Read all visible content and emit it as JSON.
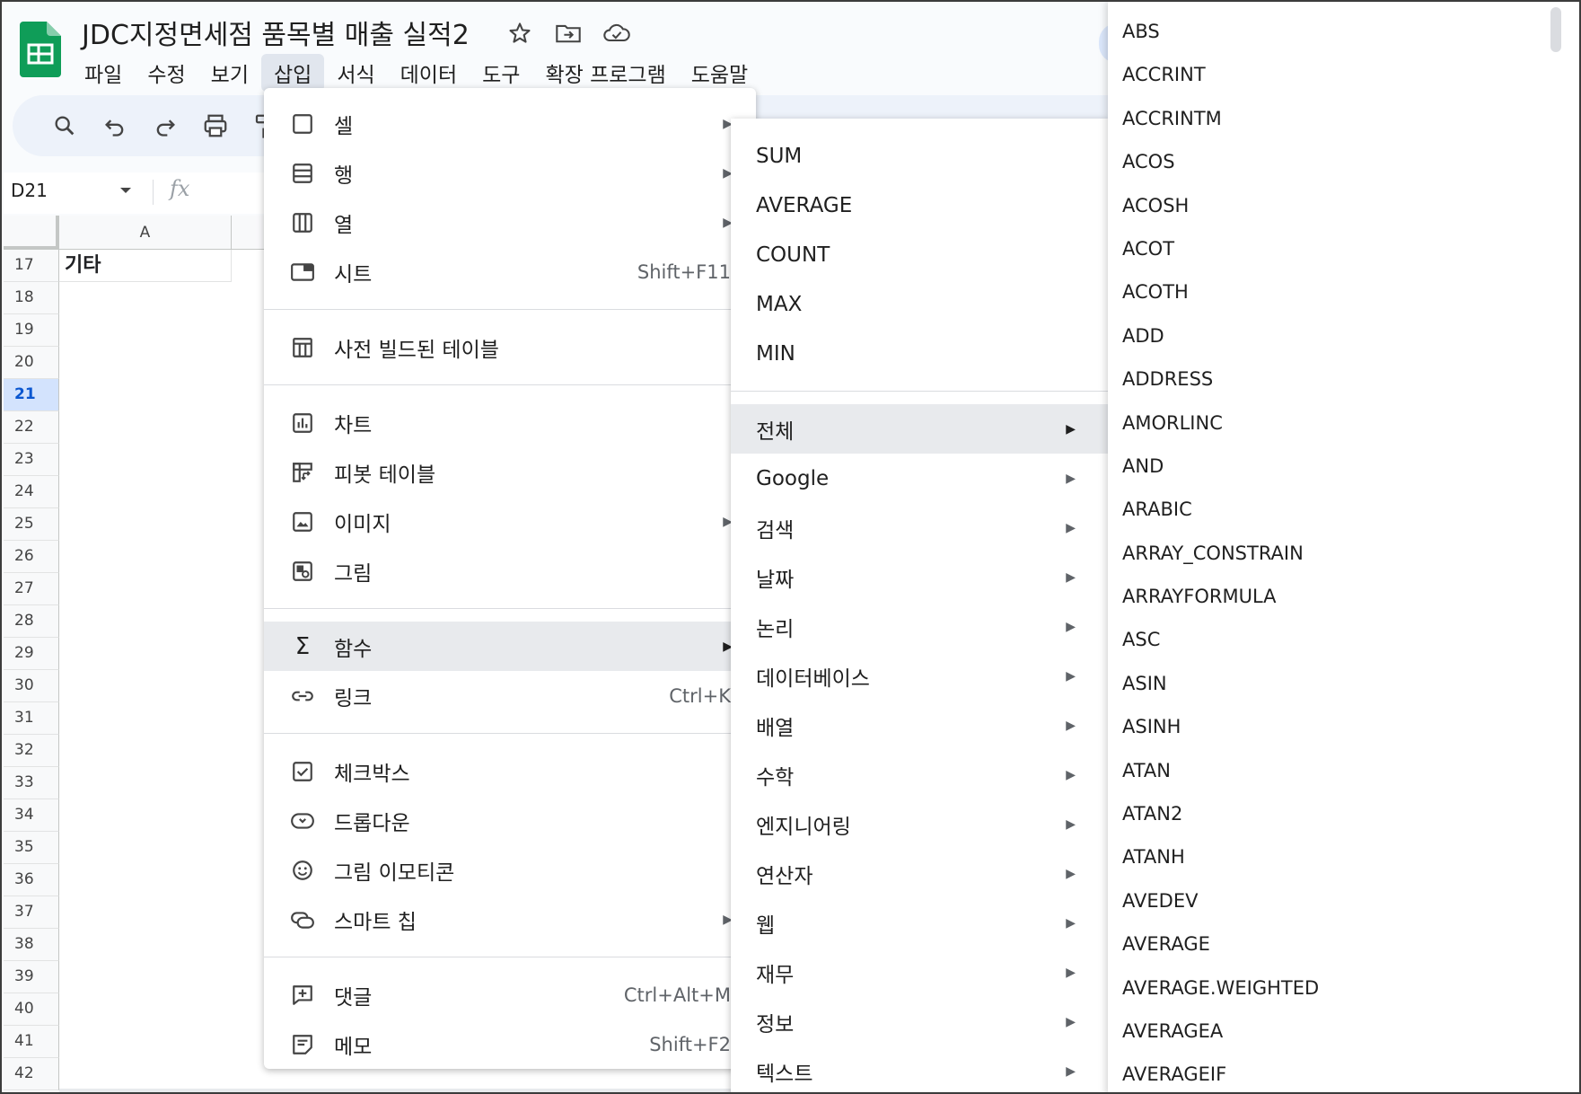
{
  "doc": {
    "title": "JDC지정면세점 품목별 매출 실적2"
  },
  "menubar": [
    "파일",
    "수정",
    "보기",
    "삽입",
    "서식",
    "데이터",
    "도구",
    "확장 프로그램",
    "도움말"
  ],
  "formula_bar": {
    "name_box": "D21"
  },
  "grid": {
    "column_a": "A",
    "cell_a17": "기타",
    "rows": [
      "17",
      "18",
      "19",
      "20",
      "21",
      "22",
      "23",
      "24",
      "25",
      "26",
      "27",
      "28",
      "29",
      "30",
      "31",
      "32",
      "33",
      "34",
      "35",
      "36",
      "37",
      "38",
      "39",
      "40",
      "41",
      "42"
    ],
    "selected_row": "21"
  },
  "insert_menu": {
    "cell": "셀",
    "row": "행",
    "column": "열",
    "sheet": "시트",
    "sheet_shortcut": "Shift+F11",
    "prebuilt_table": "사전 빌드된 테이블",
    "chart": "차트",
    "pivot_table": "피봇 테이블",
    "image": "이미지",
    "drawing": "그림",
    "function": "함수",
    "link": "링크",
    "link_shortcut": "Ctrl+K",
    "checkbox": "체크박스",
    "dropdown": "드롭다운",
    "emoji": "그림 이모티콘",
    "smart_chip": "스마트 칩",
    "comment": "댓글",
    "comment_shortcut": "Ctrl+Alt+M",
    "note": "메모",
    "note_shortcut": "Shift+F2"
  },
  "function_menu": {
    "quick": [
      "SUM",
      "AVERAGE",
      "COUNT",
      "MAX",
      "MIN"
    ],
    "categories": [
      "전체",
      "Google",
      "검색",
      "날짜",
      "논리",
      "데이터베이스",
      "배열",
      "수학",
      "엔지니어링",
      "연산자",
      "웹",
      "재무",
      "정보",
      "텍스트"
    ]
  },
  "all_functions": [
    "ABS",
    "ACCRINT",
    "ACCRINTM",
    "ACOS",
    "ACOSH",
    "ACOT",
    "ACOTH",
    "ADD",
    "ADDRESS",
    "AMORLINC",
    "AND",
    "ARABIC",
    "ARRAY_CONSTRAIN",
    "ARRAYFORMULA",
    "ASC",
    "ASIN",
    "ASINH",
    "ATAN",
    "ATAN2",
    "ATANH",
    "AVEDEV",
    "AVERAGE",
    "AVERAGE.WEIGHTED",
    "AVERAGEA",
    "AVERAGEIF"
  ],
  "colors": {
    "sheets_green": "#0f9d58",
    "toolbar_bg": "#edf2fa",
    "menu_highlight": "#e8eaed",
    "selected_row": "#d3e3fd"
  }
}
